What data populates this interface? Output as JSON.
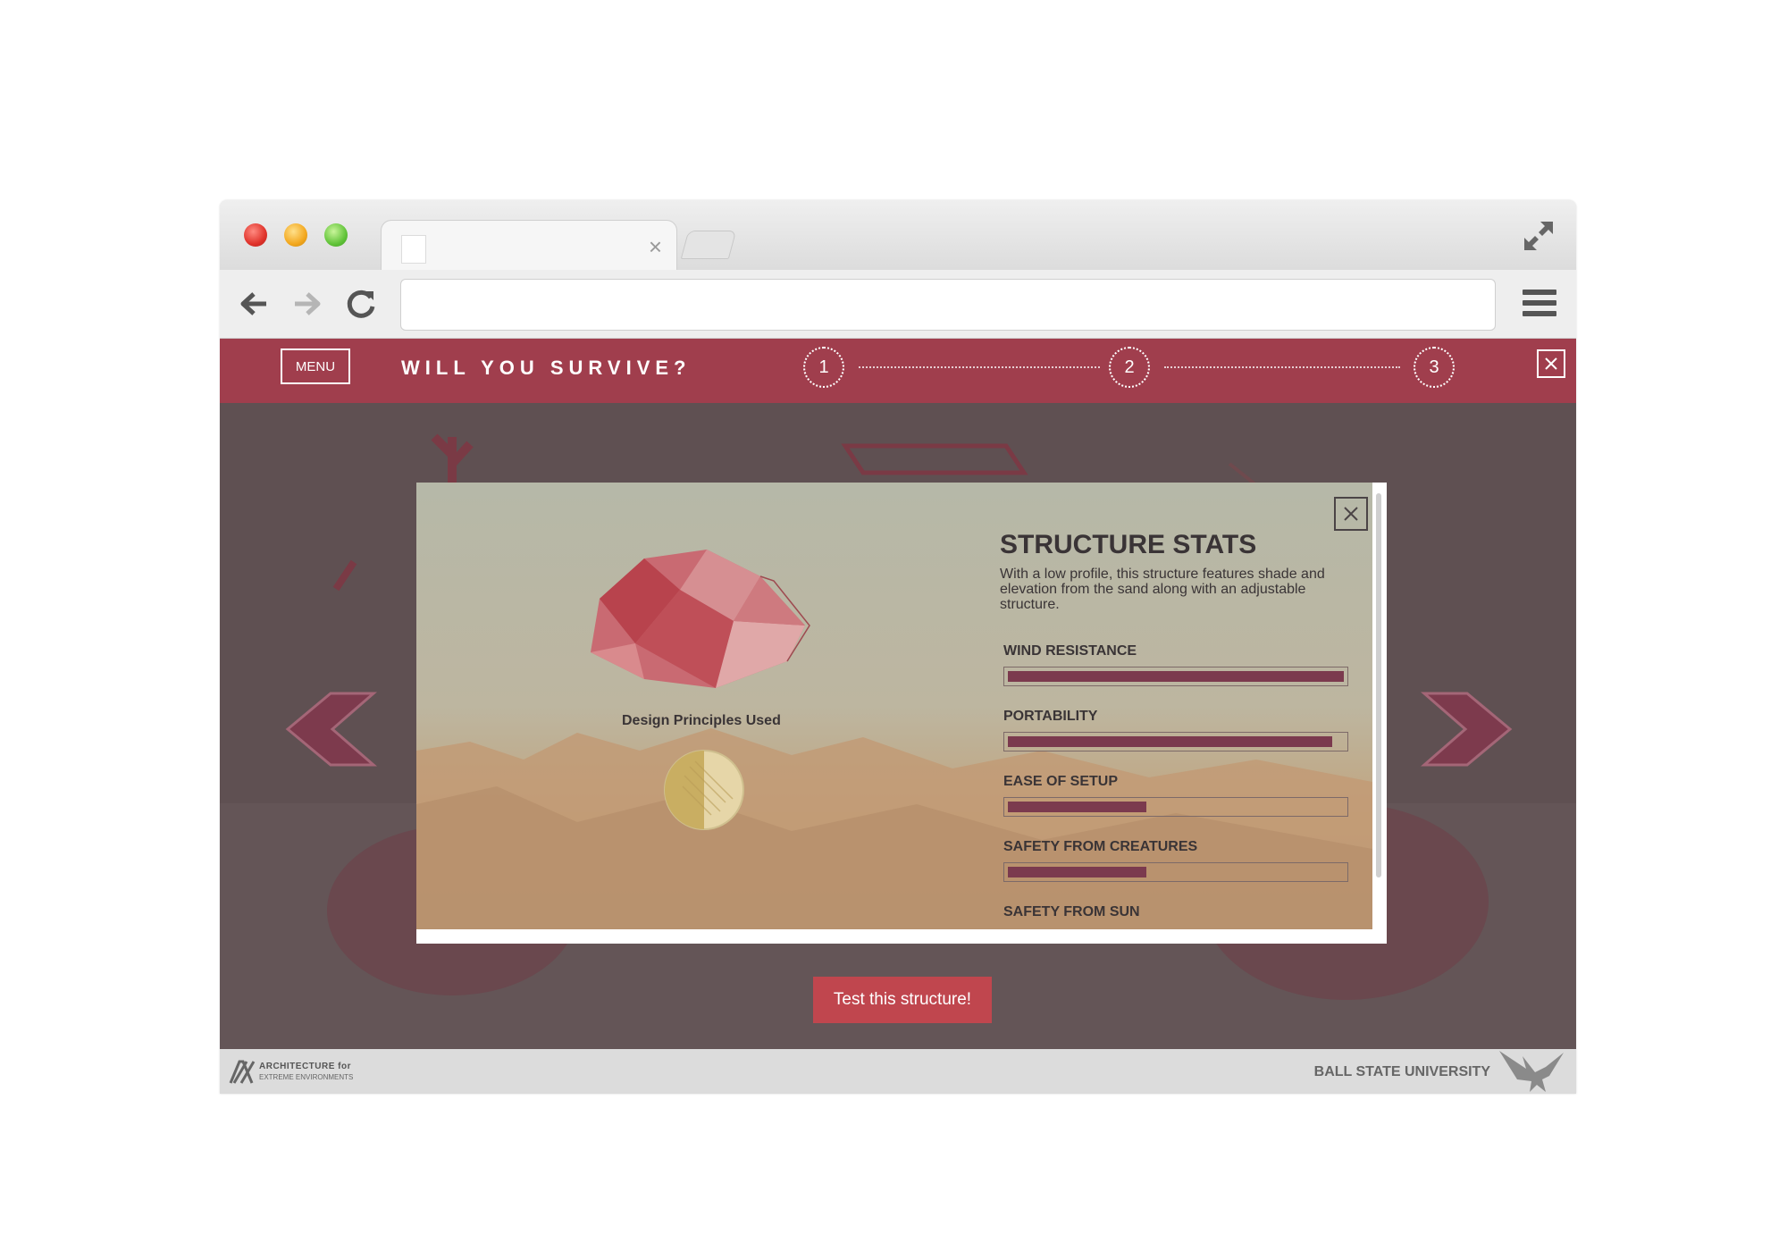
{
  "browser": {
    "tab_close": "×"
  },
  "app": {
    "menu_label": "MENU",
    "title": "WILL YOU SURVIVE?",
    "steps": [
      "1",
      "2",
      "3"
    ]
  },
  "modal": {
    "title": "STRUCTURE STATS",
    "description": "With a low profile, this structure features shade and elevation from the sand along with an adjustable structure.",
    "design_principles_label": "Design Principles Used",
    "stats": [
      {
        "label": "WIND RESISTANCE",
        "level": 0.99
      },
      {
        "label": "PORTABILITY",
        "level": 0.95
      },
      {
        "label": "EASE OF SETUP",
        "level": 0.4
      },
      {
        "label": "SAFETY FROM CREATURES",
        "level": 0.4
      },
      {
        "label": "SAFETY FROM SUN",
        "level": null
      }
    ]
  },
  "actions": {
    "test_button": "Test this structure!"
  },
  "footer": {
    "left_logo_top": "ARCHITECTURE for",
    "left_logo_bottom": "EXTREME ENVIRONMENTS",
    "right_text": "BALL STATE UNIVERSITY"
  },
  "colors": {
    "header": "#a03e4d",
    "bar_fill": "#7b3a4e",
    "test_button": "#c0464e",
    "overlay": "#5f5052"
  }
}
